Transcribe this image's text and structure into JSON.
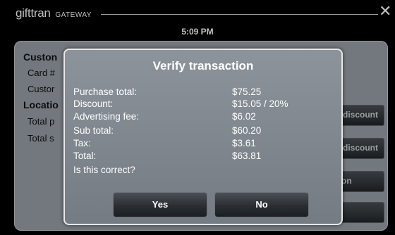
{
  "titlebar": {
    "brand": "gifttran",
    "brand_sub": "GATEWAY",
    "close_symbol": "✕",
    "time": "5:09 PM"
  },
  "background": {
    "section_customer": "Custon",
    "card_label": "Card #",
    "customer_label": "Custor",
    "section_location": "Locatio",
    "total_p_label": "Total p",
    "total_s_label": "Total s",
    "btn_discount_1": "discount",
    "btn_discount_2": "discount",
    "btn_third": "on"
  },
  "dialog": {
    "title": "Verify transaction",
    "rows": [
      {
        "label": "Purchase total:",
        "value": "$75.25"
      },
      {
        "label": "Discount:",
        "value": "$15.05 / 20%"
      },
      {
        "label": "Advertising fee:",
        "value": "$6.02"
      },
      {
        "label": "Sub total:",
        "value": "$60.20"
      },
      {
        "label": "Tax:",
        "value": "$3.61"
      },
      {
        "label": "Total:",
        "value": "$63.81"
      }
    ],
    "question": "Is this correct?",
    "yes_label": "Yes",
    "no_label": "No"
  },
  "colors": {
    "panel": "#9aa0a8",
    "dialog": "#8c939b",
    "button_dark": "#2a2e32"
  }
}
